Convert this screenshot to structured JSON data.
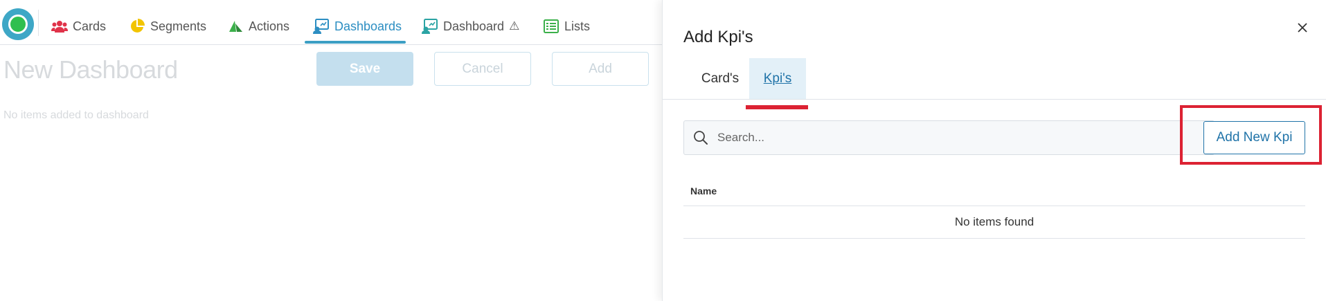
{
  "nav": {
    "items": [
      {
        "label": "Cards",
        "icon": "users-icon",
        "color": "#e0334a"
      },
      {
        "label": "Segments",
        "icon": "pie-chart-icon",
        "color": "#f2c400"
      },
      {
        "label": "Actions",
        "icon": "sail-icon",
        "color": "#3bb04a"
      },
      {
        "label": "Dashboards",
        "icon": "dashboard-icon",
        "color": "#2c8ec2",
        "active": true
      },
      {
        "label": "Dashboard",
        "icon": "dashboard-icon",
        "color": "#2aa3a3",
        "warning": "⚠"
      },
      {
        "label": "Lists",
        "icon": "list-icon",
        "color": "#3bb04a"
      }
    ]
  },
  "page": {
    "title": "New Dashboard",
    "save_label": "Save",
    "cancel_label": "Cancel",
    "add_label": "Add",
    "empty_message": "No items added to dashboard"
  },
  "panel": {
    "title": "Add Kpi's",
    "tabs": [
      {
        "label": "Card's"
      },
      {
        "label": "Kpi's",
        "active": true
      }
    ],
    "search_placeholder": "Search...",
    "add_new_label": "Add New Kpi",
    "table": {
      "columns": [
        "Name"
      ],
      "empty_text": "No items found"
    }
  },
  "colors": {
    "accent": "#2073a8",
    "highlight": "#dc2233",
    "nav_active": "#3c9fc4"
  }
}
